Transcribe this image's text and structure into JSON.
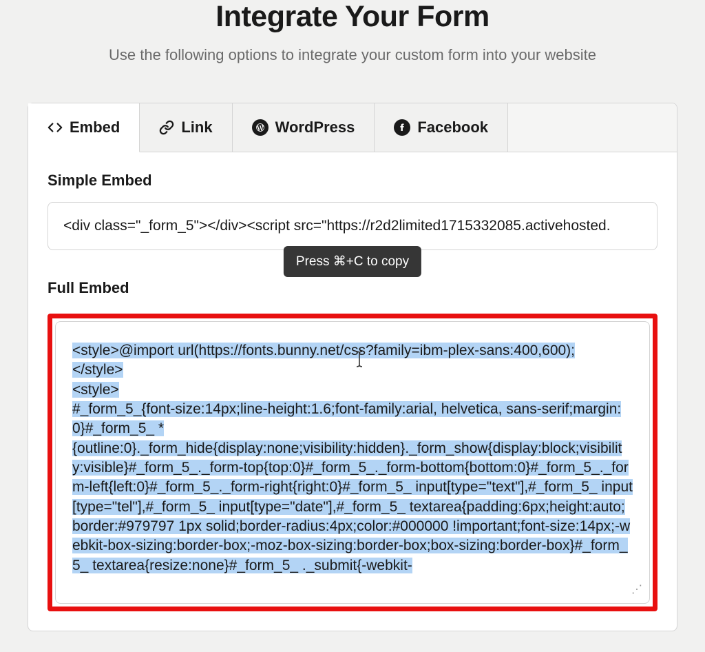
{
  "page": {
    "title": "Integrate Your Form",
    "subtitle": "Use the following options to integrate your custom form into your website"
  },
  "tabs": {
    "embed": "Embed",
    "link": "Link",
    "wordpress": "WordPress",
    "facebook": "Facebook"
  },
  "embed": {
    "simple_label": "Simple Embed",
    "simple_code": "<div class=\"_form_5\"></div><script src=\"https://r2d2limited1715332085.activehosted.",
    "full_label": "Full Embed",
    "tooltip": "Press ⌘+C to copy",
    "full_code_lines": [
      "<style>@import url(https://fonts.bunny.net/css?family=ibm-plex-sans:400,600);",
      "</style>",
      "<style>",
      "#_form_5_{font-size:14px;line-height:1.6;font-family:arial, helvetica, sans-serif;margin:0}#_form_5_ *",
      "{outline:0}._form_hide{display:none;visibility:hidden}._form_show{display:block;visibility:visible}#_form_5_._form-top{top:0}#_form_5_._form-bottom{bottom:0}#_form_5_._form-left{left:0}#_form_5_._form-right{right:0}#_form_5_ input[type=\"text\"],#_form_5_ input[type=\"tel\"],#_form_5_ input[type=\"date\"],#_form_5_ textarea{padding:6px;height:auto;border:#979797 1px solid;border-radius:4px;color:#000000 !important;font-size:14px;-webkit-box-sizing:border-box;-moz-box-sizing:border-box;box-sizing:border-box}#_form_5_ textarea{resize:none}#_form_5_ ._submit{-webkit-"
    ]
  }
}
